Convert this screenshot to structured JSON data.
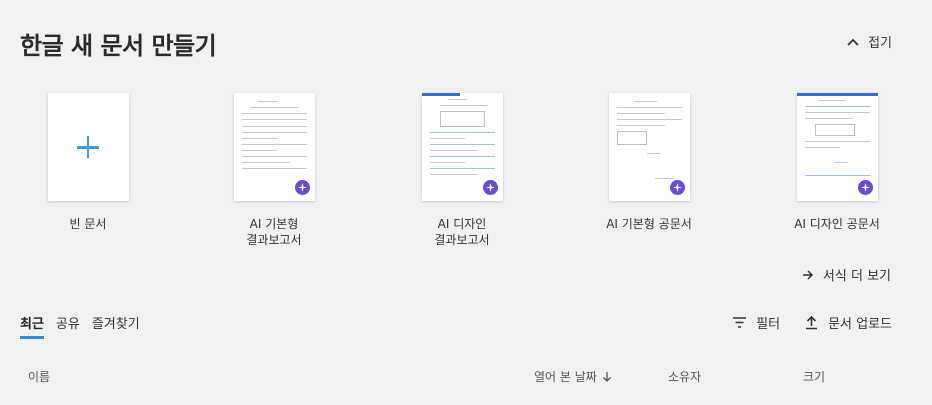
{
  "header": {
    "title": "한글 새 문서 만들기",
    "collapse_label": "접기",
    "collapse_icon": "chevron-up-icon"
  },
  "templates": [
    {
      "label": "빈 문서",
      "icon": "plus-icon",
      "accent": "#3d9be9"
    },
    {
      "label": "AI 기본형\n결과보고서",
      "badge_icon": "ai-sparkle-icon"
    },
    {
      "label": "AI 디자인\n결과보고서",
      "badge_icon": "ai-sparkle-icon"
    },
    {
      "label": "AI 기본형 공문서",
      "badge_icon": "ai-sparkle-icon"
    },
    {
      "label": "AI 디자인 공문서",
      "badge_icon": "ai-sparkle-icon"
    }
  ],
  "more_templates": {
    "label": "서식 더 보기",
    "icon": "arrow-right-icon"
  },
  "tabs": [
    {
      "label": "최근",
      "active": true
    },
    {
      "label": "공유",
      "active": false
    },
    {
      "label": "즐겨찾기",
      "active": false
    }
  ],
  "toolbar": {
    "filter_label": "필터",
    "upload_label": "문서 업로드"
  },
  "table": {
    "columns": [
      "이름",
      "열어 본 날짜",
      "소유자",
      "크기"
    ],
    "sort_column": "열어 본 날짜",
    "sort_direction": "descending"
  },
  "colors": {
    "background": "#f1f1f1",
    "accent": "#2f8be6",
    "ai_badge": "#6b4bd1"
  }
}
